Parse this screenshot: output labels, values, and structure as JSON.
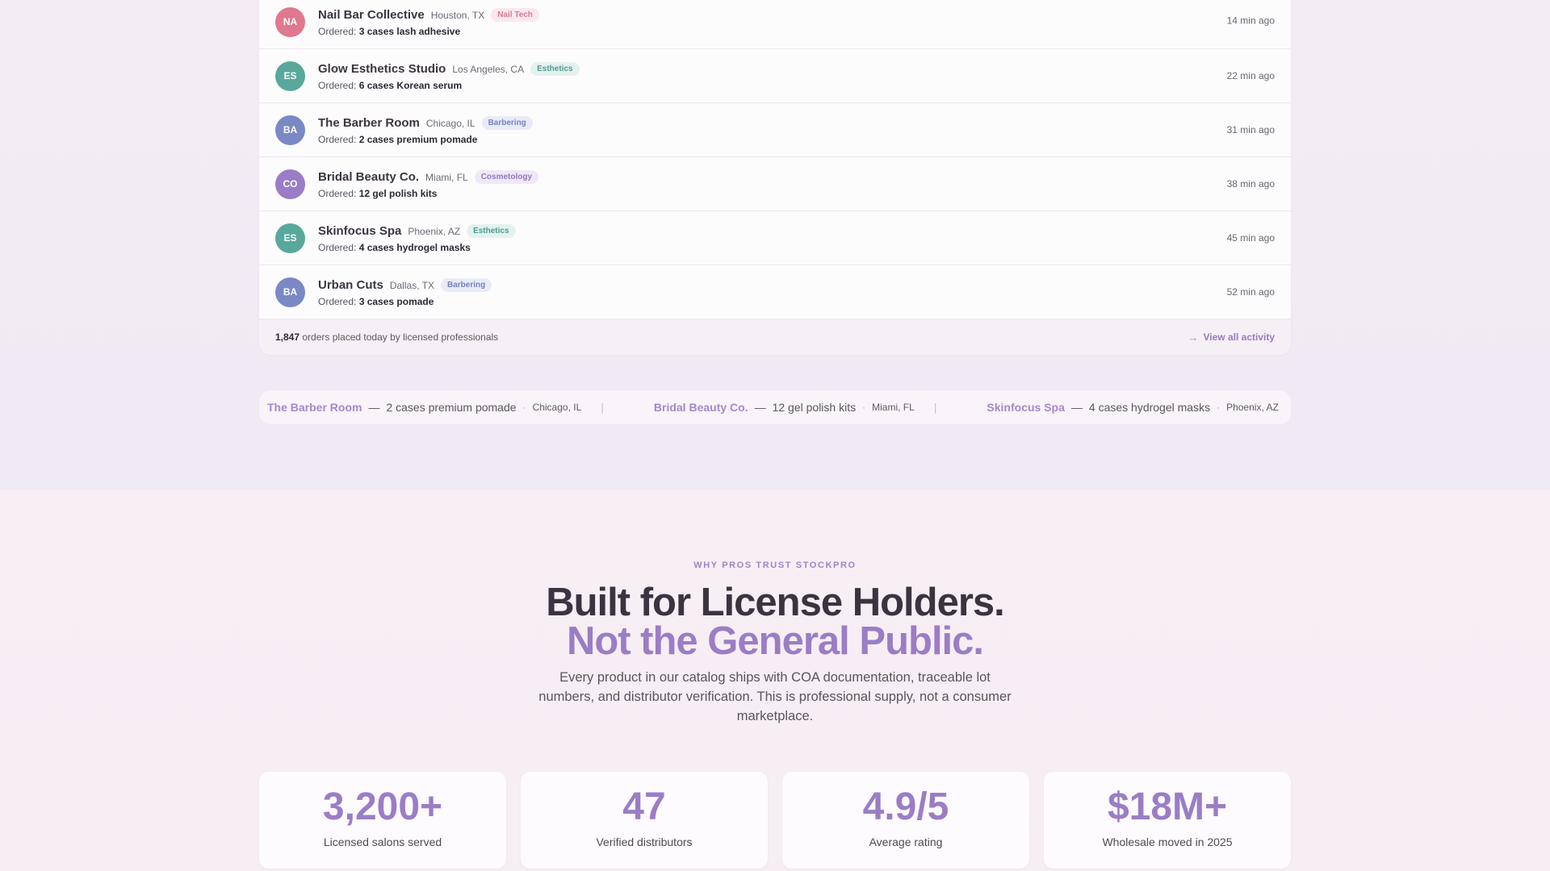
{
  "feed": {
    "rows": [
      {
        "initials": "NA",
        "avatar_color": "#e0798e",
        "name": "Nail Bar Collective",
        "location": "Houston, TX",
        "tag": "Nail Tech",
        "tag_fg": "#d87a92",
        "tag_bg": "#fbe8ee",
        "ordered_label": "Ordered:",
        "item": "3 cases lash adhesive",
        "time": "14 min ago"
      },
      {
        "initials": "ES",
        "avatar_color": "#59a89c",
        "name": "Glow Esthetics Studio",
        "location": "Los Angeles, CA",
        "tag": "Esthetics",
        "tag_fg": "#4e9c90",
        "tag_bg": "#e4f2ef",
        "ordered_label": "Ordered:",
        "item": "6 cases Korean serum",
        "time": "22 min ago"
      },
      {
        "initials": "BA",
        "avatar_color": "#7a88c6",
        "name": "The Barber Room",
        "location": "Chicago, IL",
        "tag": "Barbering",
        "tag_fg": "#7683bf",
        "tag_bg": "#e9ebf7",
        "ordered_label": "Ordered:",
        "item": "2 cases premium pomade",
        "time": "31 min ago"
      },
      {
        "initials": "CO",
        "avatar_color": "#9a7dc6",
        "name": "Bridal Beauty Co.",
        "location": "Miami, FL",
        "tag": "Cosmetology",
        "tag_fg": "#9277c0",
        "tag_bg": "#efe9f7",
        "ordered_label": "Ordered:",
        "item": "12 gel polish kits",
        "time": "38 min ago"
      },
      {
        "initials": "ES",
        "avatar_color": "#59a89c",
        "name": "Skinfocus Spa",
        "location": "Phoenix, AZ",
        "tag": "Esthetics",
        "tag_fg": "#4e9c90",
        "tag_bg": "#e4f2ef",
        "ordered_label": "Ordered:",
        "item": "4 cases hydrogel masks",
        "time": "45 min ago"
      },
      {
        "initials": "BA",
        "avatar_color": "#7a88c6",
        "name": "Urban Cuts",
        "location": "Dallas, TX",
        "tag": "Barbering",
        "tag_fg": "#7683bf",
        "tag_bg": "#e9ebf7",
        "ordered_label": "Ordered:",
        "item": "3 cases pomade",
        "time": "52 min ago"
      }
    ],
    "footer": {
      "count": "1,847",
      "text": "orders placed today by licensed professionals",
      "view_all": "View all activity"
    }
  },
  "ticker": [
    {
      "name": "The Barber Room",
      "dash": "—",
      "product": "2 cases premium pomade",
      "dot": "·",
      "location": "Chicago, IL",
      "sep": "|"
    },
    {
      "name": "Bridal Beauty Co.",
      "dash": "—",
      "product": "12 gel polish kits",
      "dot": "·",
      "location": "Miami, FL",
      "sep": "|"
    },
    {
      "name": "Skinfocus Spa",
      "dash": "—",
      "product": "4 cases hydrogel masks",
      "dot": "·",
      "location": "Phoenix, AZ",
      "sep": "|"
    }
  ],
  "why": {
    "eyebrow": "WHY PROS TRUST STOCKPRO",
    "heading_line1": "Built for License Holders.",
    "heading_line2": "Not the General Public.",
    "lede": "Every product in our catalog ships with COA documentation, traceable lot numbers, and distributor verification. This is professional supply, not a consumer marketplace."
  },
  "stats": [
    {
      "value": "3,200+",
      "label": "Licensed salons served"
    },
    {
      "value": "47",
      "label": "Verified distributors"
    },
    {
      "value": "4.9/5",
      "label": "Average rating"
    },
    {
      "value": "$18M+",
      "label": "Wholesale moved in 2025"
    }
  ],
  "colors": {
    "accent": "#9b7dc6",
    "heading": "#3b3440"
  },
  "icons": {
    "view_all": "arrow-right-icon"
  }
}
